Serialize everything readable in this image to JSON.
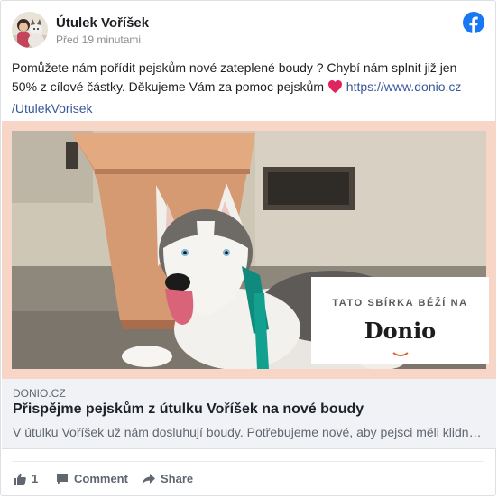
{
  "post": {
    "page_name": "Útulek Voříšek",
    "timestamp": "Před 19 minutami",
    "text_main": "Pomůžete nám pořídit pejskům nové zateplené boudy ? Chybí nám splnit již jen 50% z cílové částky. Děkujeme Vám za pomoc pejskům ",
    "text_link": "https://www.donio.cz /UtulekVorisek"
  },
  "media": {
    "promo_line": "TATO SBÍRKA BĚŽÍ NA",
    "promo_brand": "Donio"
  },
  "link_preview": {
    "domain": "DONIO.CZ",
    "title": "Přispějme pejskům z útulku Voříšek na nové boudy",
    "description": "V útulku Voříšek už nám dosluhují boudy. Potřebujeme nové, aby pejsci měli klidn…"
  },
  "actions": {
    "like_count": "1",
    "comment_label": "Comment",
    "share_label": "Share"
  },
  "colors": {
    "facebook_blue": "#1877f2",
    "link": "#385898",
    "media_border": "#f7d6c8"
  },
  "icons": [
    "facebook-logo-icon",
    "heart-icon",
    "thumbs-up-icon",
    "comment-icon",
    "share-icon"
  ]
}
